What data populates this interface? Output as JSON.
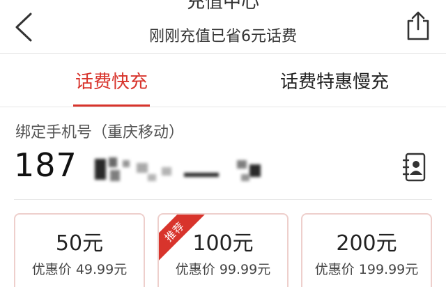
{
  "header": {
    "title": "充值中心",
    "subtitle": "刚刚充值已省6元话费",
    "back_icon": "chevron-left-icon",
    "share_icon": "share-icon"
  },
  "tabs": [
    {
      "label": "话费快充",
      "active": true
    },
    {
      "label": "话费特惠慢充",
      "active": false
    }
  ],
  "phone": {
    "label": "绑定手机号（重庆移动）",
    "number_prefix": "187",
    "contacts_icon": "contacts-book-icon"
  },
  "cards": [
    {
      "amount": "50元",
      "price": "优惠价 49.99元",
      "badge": ""
    },
    {
      "amount": "100元",
      "price": "优惠价 99.99元",
      "badge": "推荐"
    },
    {
      "amount": "200元",
      "price": "优惠价 199.99元",
      "badge": ""
    }
  ],
  "colors": {
    "accent": "#d8342c",
    "card_border": "#eecfcc"
  }
}
